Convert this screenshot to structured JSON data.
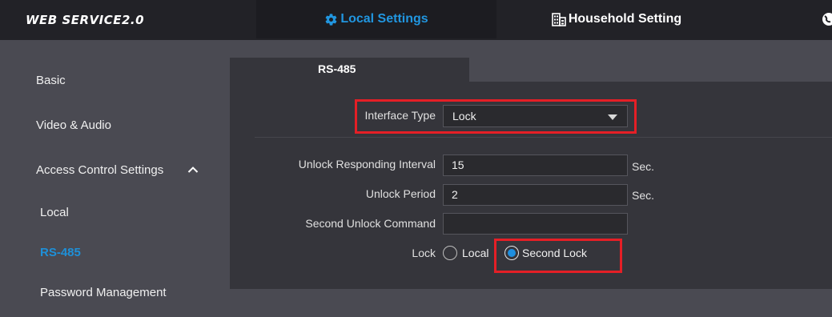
{
  "header": {
    "brand": "WEB SERVICE2.0",
    "tabs": [
      {
        "label": "Local Settings",
        "icon": "gear-icon",
        "active": true
      },
      {
        "label": "Household Setting",
        "icon": "building-icon",
        "active": false
      }
    ],
    "accent_color": "#2196e0"
  },
  "sidebar": {
    "items": [
      {
        "label": "Basic"
      },
      {
        "label": "Video & Audio"
      },
      {
        "label": "Access Control Settings",
        "expanded": true,
        "icon": "chevron-up-icon"
      }
    ],
    "subitems": [
      {
        "label": "Local"
      },
      {
        "label": "RS-485",
        "active": true
      },
      {
        "label": "Password Management"
      }
    ]
  },
  "main": {
    "tab": "RS-485",
    "interface_type": {
      "label": "Interface Type",
      "value": "Lock"
    },
    "fields": [
      {
        "label": "Unlock Responding Interval",
        "value": "15",
        "unit": "Sec."
      },
      {
        "label": "Unlock Period",
        "value": "2",
        "unit": "Sec."
      },
      {
        "label": "Second Unlock Command",
        "value": "",
        "unit": ""
      }
    ],
    "lock": {
      "label": "Lock",
      "options": [
        {
          "label": "Local",
          "checked": false
        },
        {
          "label": "Second Lock",
          "checked": true
        }
      ]
    }
  },
  "colors": {
    "highlight": "#e51f26",
    "active_radio": "#1e8fe0"
  }
}
